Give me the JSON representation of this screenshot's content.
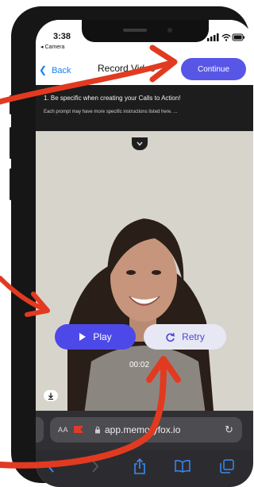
{
  "status_bar": {
    "time": "3:38",
    "back_app": "◂ Camera"
  },
  "nav": {
    "back_label": "Back",
    "title": "Record Video",
    "continue_label": "Continue"
  },
  "prompt": {
    "title": "1. Be specific when creating your Calls to Action!",
    "subtitle": "Each prompt may have more specific instructions listed here. ..."
  },
  "controls": {
    "play_label": "Play",
    "retry_label": "Retry",
    "timer": "00:02"
  },
  "browser": {
    "text_size_label": "AA",
    "url": "app.memoryfox.io"
  },
  "icons": {
    "back": "chevron-left-icon",
    "expand": "chevron-down-icon",
    "play": "play-icon",
    "retry": "refresh-icon",
    "download": "download-icon",
    "lock": "lock-icon",
    "reload": "reload-icon",
    "share": "share-icon",
    "bookmarks": "book-icon",
    "tabs": "tabs-icon"
  },
  "colors": {
    "accent": "#5856e6",
    "link_blue": "#1a7ef5",
    "annotation_red": "#e23a21",
    "prompt_bg": "#1d1d1d",
    "retry_bg": "#e7e8f4"
  }
}
